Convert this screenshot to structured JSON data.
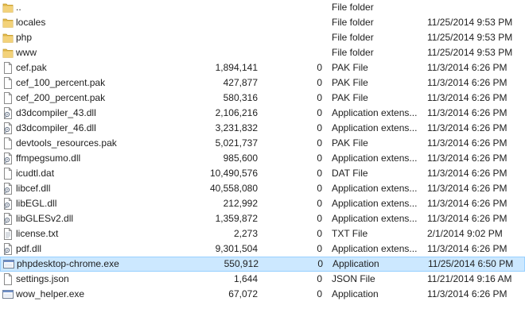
{
  "files": [
    {
      "name": "..",
      "size": "",
      "packed": "",
      "type": "File folder",
      "modified": "",
      "icon": "folder-icon"
    },
    {
      "name": "locales",
      "size": "",
      "packed": "",
      "type": "File folder",
      "modified": "11/25/2014 9:53 PM",
      "icon": "folder-icon"
    },
    {
      "name": "php",
      "size": "",
      "packed": "",
      "type": "File folder",
      "modified": "11/25/2014 9:53 PM",
      "icon": "folder-icon"
    },
    {
      "name": "www",
      "size": "",
      "packed": "",
      "type": "File folder",
      "modified": "11/25/2014 9:53 PM",
      "icon": "folder-icon"
    },
    {
      "name": "cef.pak",
      "size": "1,894,141",
      "packed": "0",
      "type": "PAK File",
      "modified": "11/3/2014 6:26 PM",
      "icon": "file-icon"
    },
    {
      "name": "cef_100_percent.pak",
      "size": "427,877",
      "packed": "0",
      "type": "PAK File",
      "modified": "11/3/2014 6:26 PM",
      "icon": "file-icon"
    },
    {
      "name": "cef_200_percent.pak",
      "size": "580,316",
      "packed": "0",
      "type": "PAK File",
      "modified": "11/3/2014 6:26 PM",
      "icon": "file-icon"
    },
    {
      "name": "d3dcompiler_43.dll",
      "size": "2,106,216",
      "packed": "0",
      "type": "Application extens...",
      "modified": "11/3/2014 6:26 PM",
      "icon": "dll-icon"
    },
    {
      "name": "d3dcompiler_46.dll",
      "size": "3,231,832",
      "packed": "0",
      "type": "Application extens...",
      "modified": "11/3/2014 6:26 PM",
      "icon": "dll-icon"
    },
    {
      "name": "devtools_resources.pak",
      "size": "5,021,737",
      "packed": "0",
      "type": "PAK File",
      "modified": "11/3/2014 6:26 PM",
      "icon": "file-icon"
    },
    {
      "name": "ffmpegsumo.dll",
      "size": "985,600",
      "packed": "0",
      "type": "Application extens...",
      "modified": "11/3/2014 6:26 PM",
      "icon": "dll-icon"
    },
    {
      "name": "icudtl.dat",
      "size": "10,490,576",
      "packed": "0",
      "type": "DAT File",
      "modified": "11/3/2014 6:26 PM",
      "icon": "file-icon"
    },
    {
      "name": "libcef.dll",
      "size": "40,558,080",
      "packed": "0",
      "type": "Application extens...",
      "modified": "11/3/2014 6:26 PM",
      "icon": "dll-icon"
    },
    {
      "name": "libEGL.dll",
      "size": "212,992",
      "packed": "0",
      "type": "Application extens...",
      "modified": "11/3/2014 6:26 PM",
      "icon": "dll-icon"
    },
    {
      "name": "libGLESv2.dll",
      "size": "1,359,872",
      "packed": "0",
      "type": "Application extens...",
      "modified": "11/3/2014 6:26 PM",
      "icon": "dll-icon"
    },
    {
      "name": "license.txt",
      "size": "2,273",
      "packed": "0",
      "type": "TXT File",
      "modified": "2/1/2014 9:02 PM",
      "icon": "text-file-icon"
    },
    {
      "name": "pdf.dll",
      "size": "9,301,504",
      "packed": "0",
      "type": "Application extens...",
      "modified": "11/3/2014 6:26 PM",
      "icon": "dll-icon"
    },
    {
      "name": "phpdesktop-chrome.exe",
      "size": "550,912",
      "packed": "0",
      "type": "Application",
      "modified": "11/25/2014 6:50 PM",
      "icon": "exe-icon",
      "selected": true
    },
    {
      "name": "settings.json",
      "size": "1,644",
      "packed": "0",
      "type": "JSON File",
      "modified": "11/21/2014 9:16 AM",
      "icon": "file-icon"
    },
    {
      "name": "wow_helper.exe",
      "size": "67,072",
      "packed": "0",
      "type": "Application",
      "modified": "11/3/2014 6:26 PM",
      "icon": "exe-icon"
    }
  ],
  "colors": {
    "selection_fill": "#cce8ff",
    "selection_border": "#99d1ff",
    "folder": "#e8c05a"
  }
}
